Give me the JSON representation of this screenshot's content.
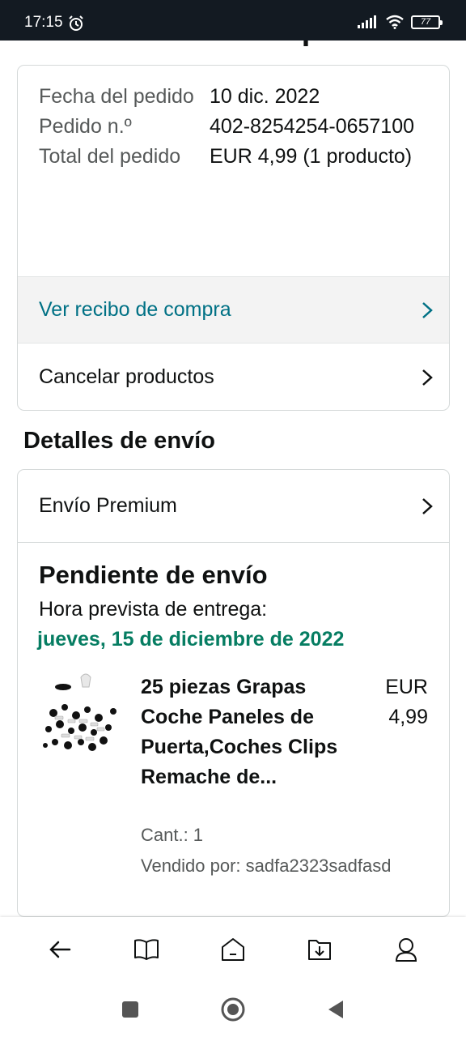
{
  "status_bar": {
    "time": "17:15",
    "battery": "77"
  },
  "page": {
    "title": "Ver los detalles del pedido"
  },
  "order_summary": {
    "rows": [
      {
        "label": "Fecha del pedido",
        "value": "10 dic. 2022"
      },
      {
        "label": "Pedido n.º",
        "value": "402-8254254-0657100"
      },
      {
        "label": "Total del pedido",
        "value": "EUR 4,99 (1 producto)"
      }
    ],
    "receipt_link": "Ver recibo de compra",
    "cancel_link": "Cancelar productos"
  },
  "shipping": {
    "section_title": "Detalles de envío",
    "shipping_method": "Envío Premium",
    "status": "Pendiente de envío",
    "eta_label": "Hora prevista de entrega:",
    "eta_date": "jueves, 15 de diciembre de 2022",
    "product": {
      "title": "25 piezas Grapas Coche Paneles de Puerta,Coches Clips Remache de...",
      "price_currency": "EUR",
      "price_amount": "4,99",
      "quantity": "Cant.: 1",
      "seller": "Vendido por: sadfa2323sadfasd"
    }
  },
  "bottom_nav": {
    "items": [
      {
        "icon": "back-arrow-icon"
      },
      {
        "icon": "book-icon"
      },
      {
        "icon": "home-icon"
      },
      {
        "icon": "download-icon"
      },
      {
        "icon": "account-icon"
      }
    ]
  },
  "colors": {
    "link": "#007185",
    "delivery_green": "#067d62",
    "status_bar": "#131a22"
  }
}
